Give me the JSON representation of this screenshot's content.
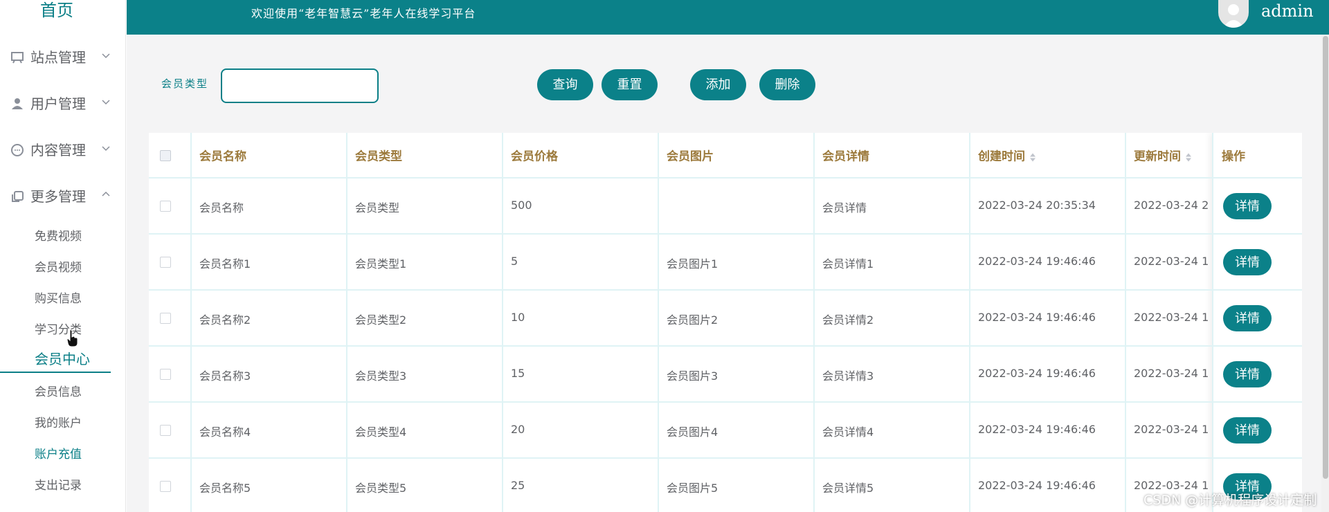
{
  "sidebar": {
    "home": "首页",
    "menus": [
      {
        "label": "站点管理",
        "icon": "monitor-icon"
      },
      {
        "label": "用户管理",
        "icon": "user-icon"
      },
      {
        "label": "内容管理",
        "icon": "chat-icon"
      },
      {
        "label": "更多管理",
        "icon": "copy-icon"
      }
    ],
    "sub_items": [
      "免费视频",
      "会员视频",
      "购买信息",
      "学习分类",
      "会员中心",
      "会员信息",
      "我的账户",
      "账户充值",
      "支出记录"
    ]
  },
  "header": {
    "title": "欢迎使用“老年智慧云”老年人在线学习平台",
    "user": "admin"
  },
  "search": {
    "label": "会员类型",
    "value": "",
    "placeholder": ""
  },
  "buttons": {
    "query": "查询",
    "reset": "重置",
    "add": "添加",
    "delete": "删除"
  },
  "table": {
    "headers": [
      "会员名称",
      "会员类型",
      "会员价格",
      "会员图片",
      "会员详情",
      "创建时间",
      "更新时间",
      "操作"
    ],
    "detail_label": "详情",
    "rows": [
      {
        "name": "会员名称",
        "type": "会员类型",
        "price": "500",
        "image": "",
        "detail": "会员详情",
        "created": "2022-03-24 20:35:34",
        "updated": "2022-03-24 2"
      },
      {
        "name": "会员名称1",
        "type": "会员类型1",
        "price": "5",
        "image": "会员图片1",
        "detail": "会员详情1",
        "created": "2022-03-24 19:46:46",
        "updated": "2022-03-24 1"
      },
      {
        "name": "会员名称2",
        "type": "会员类型2",
        "price": "10",
        "image": "会员图片2",
        "detail": "会员详情2",
        "created": "2022-03-24 19:46:46",
        "updated": "2022-03-24 1"
      },
      {
        "name": "会员名称3",
        "type": "会员类型3",
        "price": "15",
        "image": "会员图片3",
        "detail": "会员详情3",
        "created": "2022-03-24 19:46:46",
        "updated": "2022-03-24 1"
      },
      {
        "name": "会员名称4",
        "type": "会员类型4",
        "price": "20",
        "image": "会员图片4",
        "detail": "会员详情4",
        "created": "2022-03-24 19:46:46",
        "updated": "2022-03-24 1"
      },
      {
        "name": "会员名称5",
        "type": "会员类型5",
        "price": "25",
        "image": "会员图片5",
        "detail": "会员详情5",
        "created": "2022-03-24 19:46:46",
        "updated": "2022-03-24 1"
      }
    ]
  },
  "watermark": "CSDN @计算机程序设计定制",
  "colors": {
    "primary": "#0b8189",
    "header_text": "#9c7a3c"
  }
}
